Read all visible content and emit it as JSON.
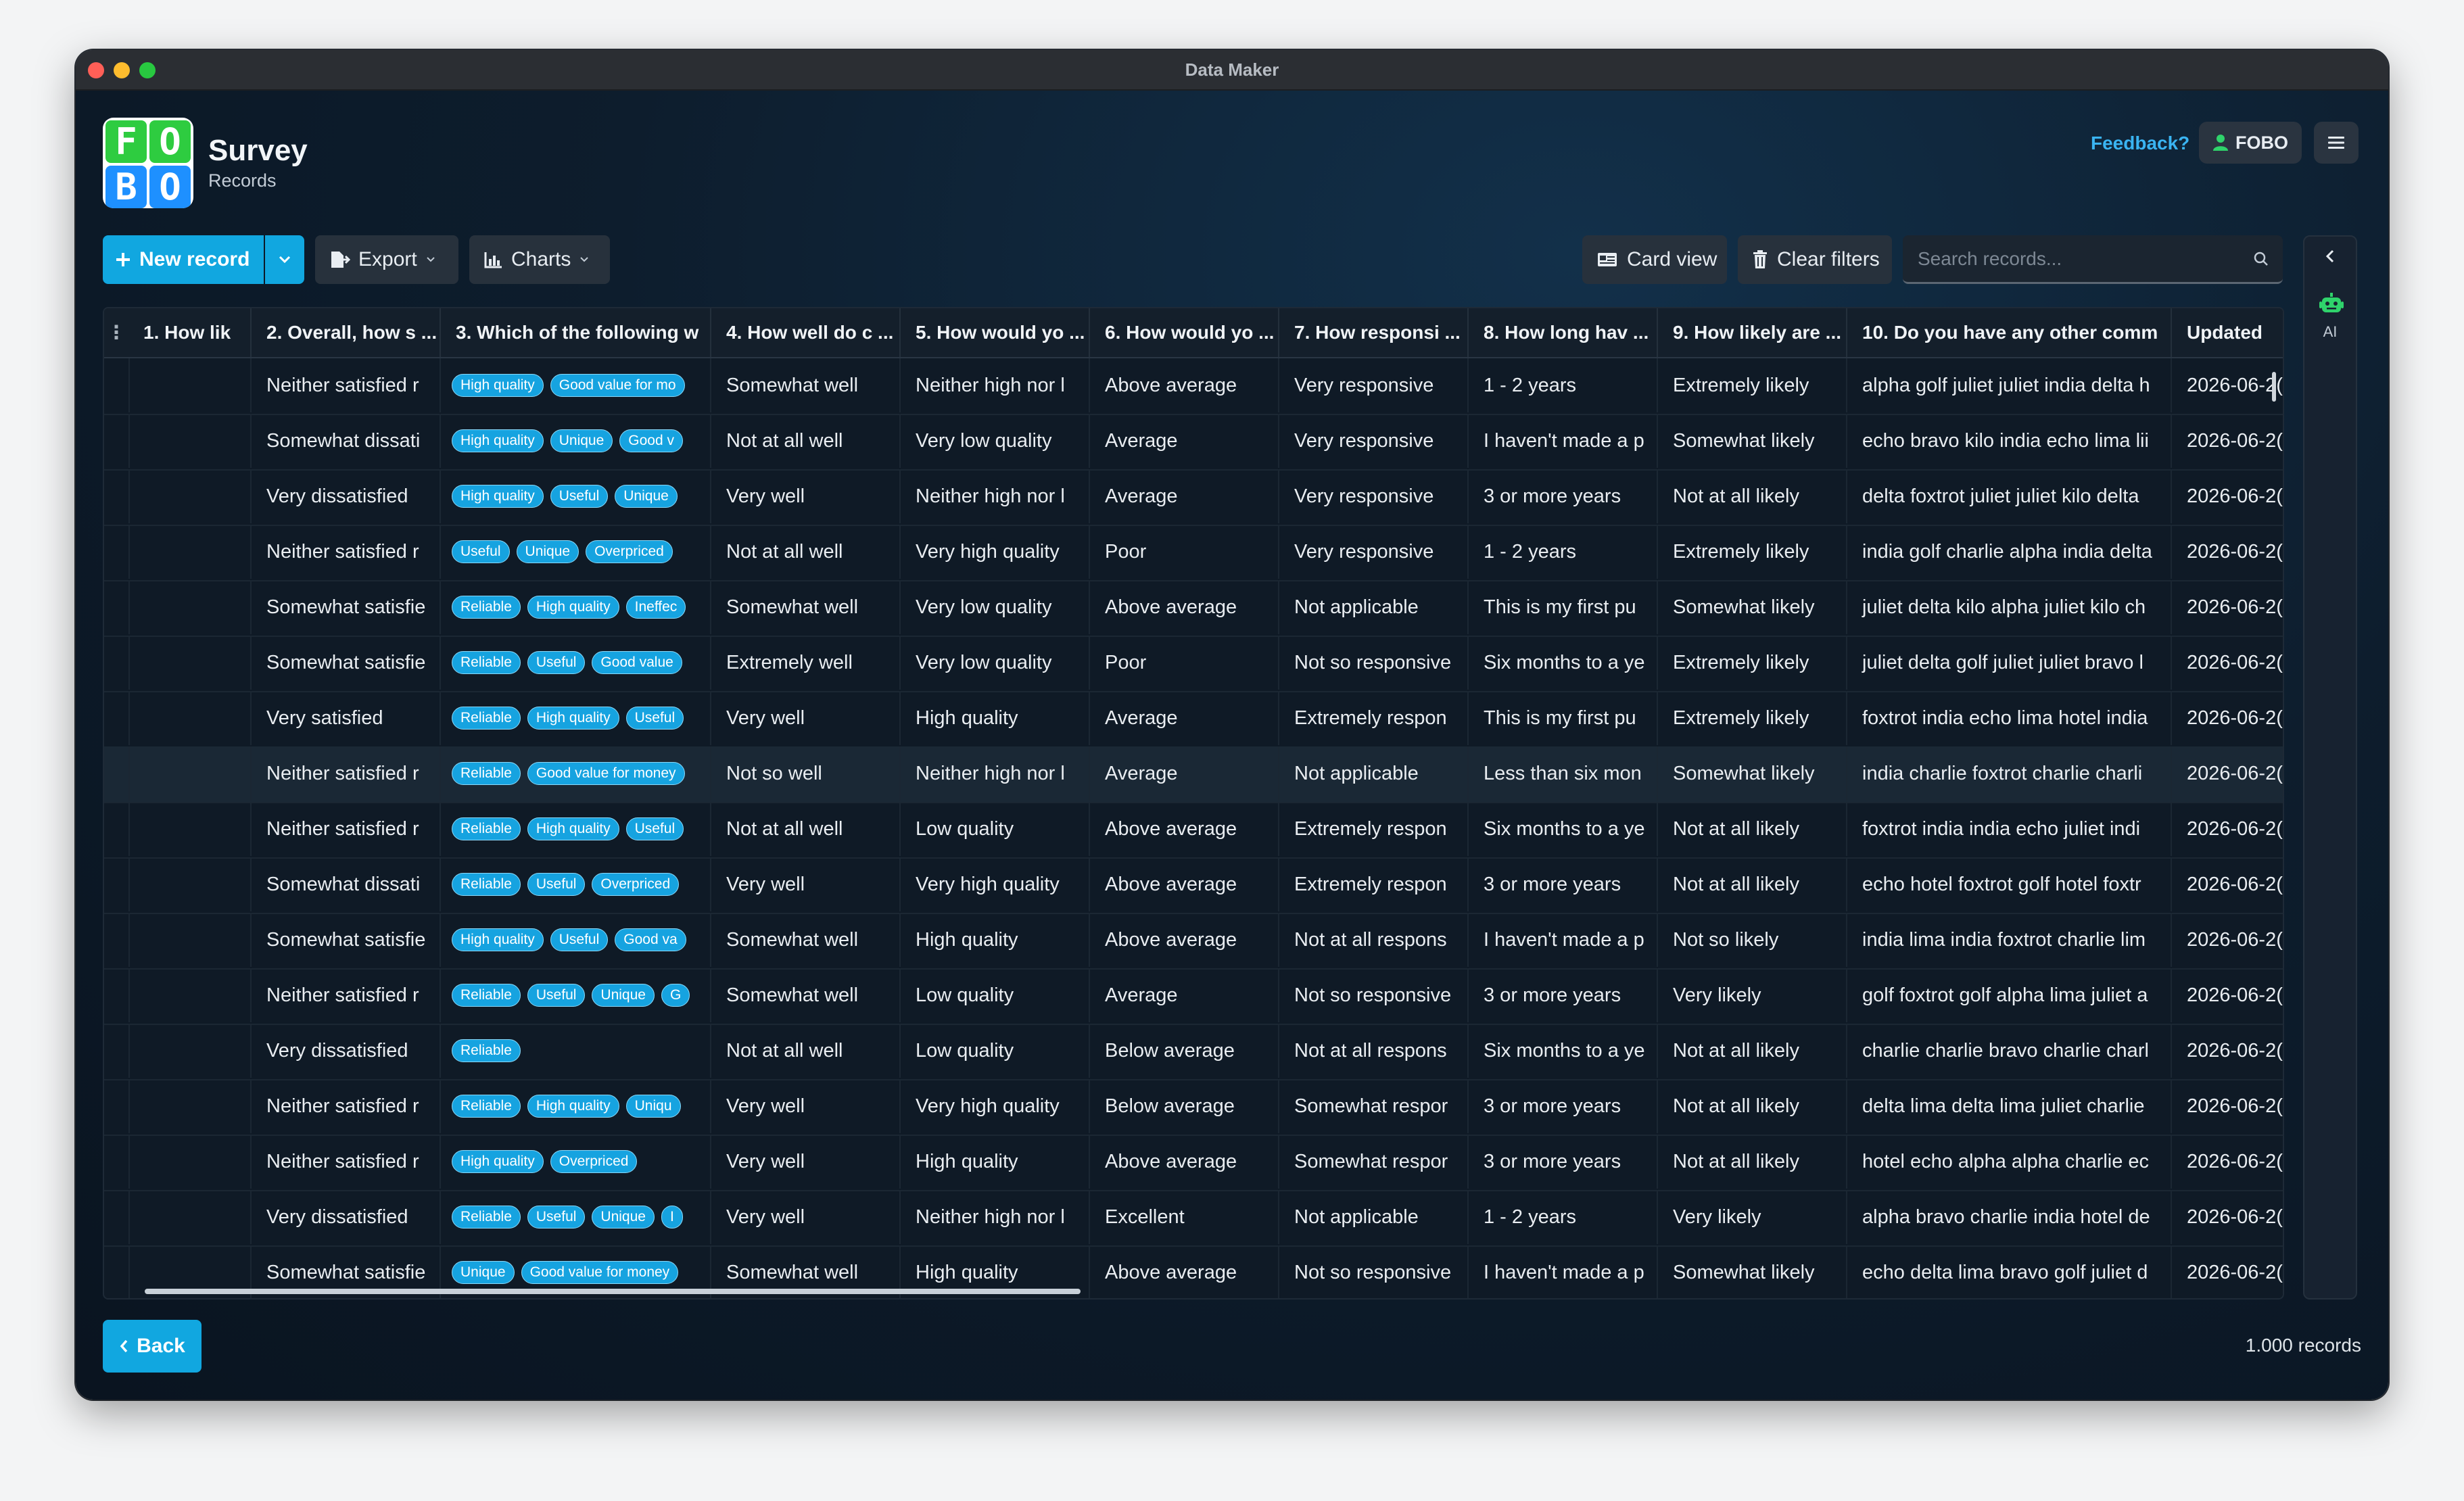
{
  "window": {
    "title": "Data Maker"
  },
  "logo": {
    "letters": [
      "F",
      "O",
      "B",
      "O"
    ]
  },
  "header": {
    "title": "Survey",
    "subtitle": "Records",
    "feedback_label": "Feedback?",
    "user_label": "FOBO"
  },
  "toolbar": {
    "new_record_label": "New record",
    "export_label": "Export",
    "charts_label": "Charts",
    "card_view_label": "Card view",
    "clear_filters_label": "Clear filters",
    "search_placeholder": "Search records..."
  },
  "rail": {
    "ai_label": "AI"
  },
  "colors": {
    "accent": "#11a7e0",
    "chip": "#16a3e0",
    "link": "#3ab4f2"
  },
  "table": {
    "columns": [
      "1. How lik",
      "2. Overall, how s ...",
      "3. Which of the following w",
      "4. How well do c ...",
      "5. How would yo ...",
      "6. How would yo ...",
      "7. How responsi ...",
      "8. How long hav ...",
      "9. How likely are ...",
      "10. Do you have any other comm",
      "Updated"
    ],
    "rows": [
      {
        "c1": "",
        "c2": "Neither satisfied r",
        "tags": [
          "High quality",
          "Good value for mo"
        ],
        "c4": "Somewhat well",
        "c5": "Neither high nor l",
        "c6": "Above average",
        "c7": "Very responsive",
        "c8": "1 - 2 years",
        "c9": "Extremely likely",
        "c10": "alpha golf juliet juliet india delta h",
        "updated": "2026-06-2("
      },
      {
        "c1": "",
        "c2": "Somewhat dissati",
        "tags": [
          "High quality",
          "Unique",
          "Good v"
        ],
        "c4": "Not at all well",
        "c5": "Very low quality",
        "c6": "Average",
        "c7": "Very responsive",
        "c8": "I haven't made a p",
        "c9": "Somewhat likely",
        "c10": "echo bravo kilo india echo lima lii",
        "updated": "2026-06-2("
      },
      {
        "c1": "",
        "c2": "Very dissatisfied",
        "tags": [
          "High quality",
          "Useful",
          "Unique"
        ],
        "c4": "Very well",
        "c5": "Neither high nor l",
        "c6": "Average",
        "c7": "Very responsive",
        "c8": "3 or more years",
        "c9": "Not at all likely",
        "c10": "delta foxtrot juliet juliet kilo delta",
        "updated": "2026-06-2("
      },
      {
        "c1": "",
        "c2": "Neither satisfied r",
        "tags": [
          "Useful",
          "Unique",
          "Overpriced"
        ],
        "c4": "Not at all well",
        "c5": "Very high quality",
        "c6": "Poor",
        "c7": "Very responsive",
        "c8": "1 - 2 years",
        "c9": "Extremely likely",
        "c10": "india golf charlie alpha india delta",
        "updated": "2026-06-2("
      },
      {
        "c1": "",
        "c2": "Somewhat satisfie",
        "tags": [
          "Reliable",
          "High quality",
          "Ineffec"
        ],
        "c4": "Somewhat well",
        "c5": "Very low quality",
        "c6": "Above average",
        "c7": "Not applicable",
        "c8": "This is my first pu",
        "c9": "Somewhat likely",
        "c10": "juliet delta kilo alpha juliet kilo ch",
        "updated": "2026-06-2("
      },
      {
        "c1": "",
        "c2": "Somewhat satisfie",
        "tags": [
          "Reliable",
          "Useful",
          "Good value"
        ],
        "c4": "Extremely well",
        "c5": "Very low quality",
        "c6": "Poor",
        "c7": "Not so responsive",
        "c8": "Six months to a ye",
        "c9": "Extremely likely",
        "c10": "juliet delta golf juliet juliet bravo l",
        "updated": "2026-06-2("
      },
      {
        "c1": "",
        "c2": "Very satisfied",
        "tags": [
          "Reliable",
          "High quality",
          "Useful"
        ],
        "c4": "Very well",
        "c5": "High quality",
        "c6": "Average",
        "c7": "Extremely respon",
        "c8": "This is my first pu",
        "c9": "Extremely likely",
        "c10": "foxtrot india echo lima hotel india",
        "updated": "2026-06-2("
      },
      {
        "c1": "",
        "c2": "Neither satisfied r",
        "tags": [
          "Reliable",
          "Good value for money"
        ],
        "c4": "Not so well",
        "c5": "Neither high nor l",
        "c6": "Average",
        "c7": "Not applicable",
        "c8": "Less than six mon",
        "c9": "Somewhat likely",
        "c10": "india charlie foxtrot charlie charli",
        "updated": "2026-06-2("
      },
      {
        "c1": "",
        "c2": "Neither satisfied r",
        "tags": [
          "Reliable",
          "High quality",
          "Useful"
        ],
        "c4": "Not at all well",
        "c5": "Low quality",
        "c6": "Above average",
        "c7": "Extremely respon",
        "c8": "Six months to a ye",
        "c9": "Not at all likely",
        "c10": "foxtrot india india echo juliet indi",
        "updated": "2026-06-2("
      },
      {
        "c1": "",
        "c2": "Somewhat dissati",
        "tags": [
          "Reliable",
          "Useful",
          "Overpriced"
        ],
        "c4": "Very well",
        "c5": "Very high quality",
        "c6": "Above average",
        "c7": "Extremely respon",
        "c8": "3 or more years",
        "c9": "Not at all likely",
        "c10": "echo hotel foxtrot golf hotel foxtr",
        "updated": "2026-06-2("
      },
      {
        "c1": "",
        "c2": "Somewhat satisfie",
        "tags": [
          "High quality",
          "Useful",
          "Good va"
        ],
        "c4": "Somewhat well",
        "c5": "High quality",
        "c6": "Above average",
        "c7": "Not at all respons",
        "c8": "I haven't made a p",
        "c9": "Not so likely",
        "c10": "india lima india foxtrot charlie lim",
        "updated": "2026-06-2("
      },
      {
        "c1": "",
        "c2": "Neither satisfied r",
        "tags": [
          "Reliable",
          "Useful",
          "Unique",
          "G"
        ],
        "c4": "Somewhat well",
        "c5": "Low quality",
        "c6": "Average",
        "c7": "Not so responsive",
        "c8": "3 or more years",
        "c9": "Very likely",
        "c10": "golf foxtrot golf alpha lima juliet a",
        "updated": "2026-06-2("
      },
      {
        "c1": "",
        "c2": "Very dissatisfied",
        "tags": [
          "Reliable"
        ],
        "c4": "Not at all well",
        "c5": "Low quality",
        "c6": "Below average",
        "c7": "Not at all respons",
        "c8": "Six months to a ye",
        "c9": "Not at all likely",
        "c10": "charlie charlie bravo charlie charl",
        "updated": "2026-06-2("
      },
      {
        "c1": "",
        "c2": "Neither satisfied r",
        "tags": [
          "Reliable",
          "High quality",
          "Uniqu"
        ],
        "c4": "Very well",
        "c5": "Very high quality",
        "c6": "Below average",
        "c7": "Somewhat respor",
        "c8": "3 or more years",
        "c9": "Not at all likely",
        "c10": "delta lima delta lima juliet charlie",
        "updated": "2026-06-2("
      },
      {
        "c1": "",
        "c2": "Neither satisfied r",
        "tags": [
          "High quality",
          "Overpriced"
        ],
        "c4": "Very well",
        "c5": "High quality",
        "c6": "Above average",
        "c7": "Somewhat respor",
        "c8": "3 or more years",
        "c9": "Not at all likely",
        "c10": "hotel echo alpha alpha charlie ec",
        "updated": "2026-06-2("
      },
      {
        "c1": "",
        "c2": "Very dissatisfied",
        "tags": [
          "Reliable",
          "Useful",
          "Unique",
          "I"
        ],
        "c4": "Very well",
        "c5": "Neither high nor l",
        "c6": "Excellent",
        "c7": "Not applicable",
        "c8": "1 - 2 years",
        "c9": "Very likely",
        "c10": "alpha bravo charlie india hotel de",
        "updated": "2026-06-2("
      },
      {
        "c1": "",
        "c2": "Somewhat satisfie",
        "tags": [
          "Unique",
          "Good value for money"
        ],
        "c4": "Somewhat well",
        "c5": "High quality",
        "c6": "Above average",
        "c7": "Not so responsive",
        "c8": "I haven't made a p",
        "c9": "Somewhat likely",
        "c10": "echo delta lima bravo golf juliet d",
        "updated": "2026-06-2("
      }
    ]
  },
  "footer": {
    "back_label": "Back",
    "record_count": "1.000 records"
  }
}
